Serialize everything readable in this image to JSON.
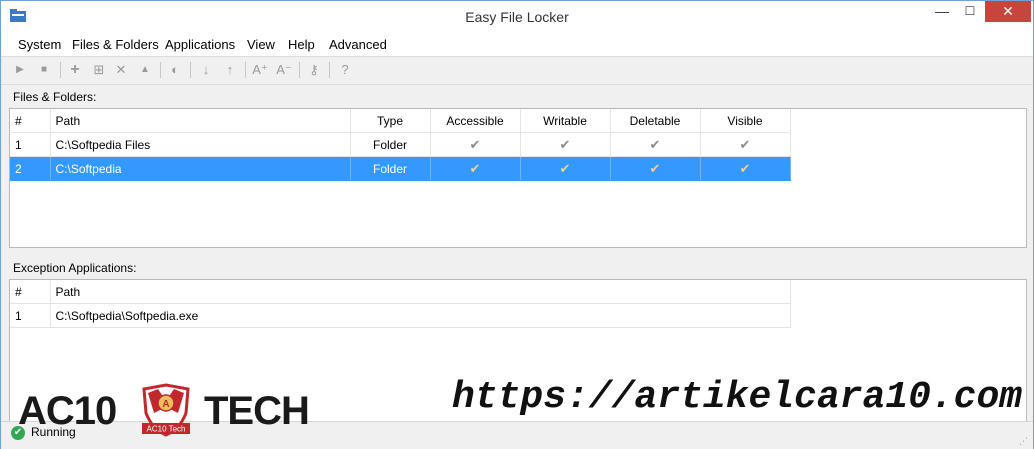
{
  "window": {
    "title": "Easy File Locker",
    "controls": {
      "minimize": "—",
      "maximize": "☐",
      "close": "✕"
    }
  },
  "menu": [
    "System",
    "Files & Folders",
    "Applications",
    "View",
    "Help",
    "Advanced"
  ],
  "toolbar": {
    "icons": [
      "play-icon",
      "stop-icon",
      "add-icon",
      "add-multiple-icon",
      "delete-icon",
      "move-up-icon",
      "toggle-icon",
      "arrow-down-icon",
      "arrow-up-icon",
      "font-increase-icon",
      "font-decrease-icon",
      "key-icon",
      "help-icon"
    ],
    "glyphs": {
      "play": "▶",
      "stop": "■",
      "add": "+",
      "add_multi": "⊞",
      "delete": "✕",
      "up": "▲",
      "toggle": "◐",
      "down": "↓",
      "arrow_up": "↑",
      "font_inc": "A⁺",
      "font_dec": "A⁻",
      "key": "⚷",
      "help": "?"
    }
  },
  "files_section": {
    "label": "Files & Folders:",
    "columns": [
      "#",
      "Path",
      "Type",
      "Accessible",
      "Writable",
      "Deletable",
      "Visible"
    ],
    "rows": [
      {
        "num": "1",
        "path": "C:\\Softpedia Files",
        "type": "Folder",
        "accessible": "✔",
        "writable": "✔",
        "deletable": "✔",
        "visible": "✔",
        "selected": false
      },
      {
        "num": "2",
        "path": "C:\\Softpedia",
        "type": "Folder",
        "accessible": "✔",
        "writable": "✔",
        "deletable": "✔",
        "visible": "✔",
        "selected": true
      }
    ]
  },
  "exceptions_section": {
    "label": "Exception Applications:",
    "columns": [
      "#",
      "Path"
    ],
    "rows": [
      {
        "num": "1",
        "path": "C:\\Softpedia\\Softpedia.exe"
      }
    ]
  },
  "status": {
    "text": "Running",
    "icon": "running-check-icon"
  },
  "watermark": {
    "logo_left": "AC10",
    "logo_right": "TECH",
    "shield_text": "AC10 Tech",
    "shield_letter": "A",
    "url": "https://artikelcara10.com"
  },
  "colors": {
    "selection": "#3399ff",
    "close_button": "#c7453d",
    "status_ok": "#33a853"
  }
}
